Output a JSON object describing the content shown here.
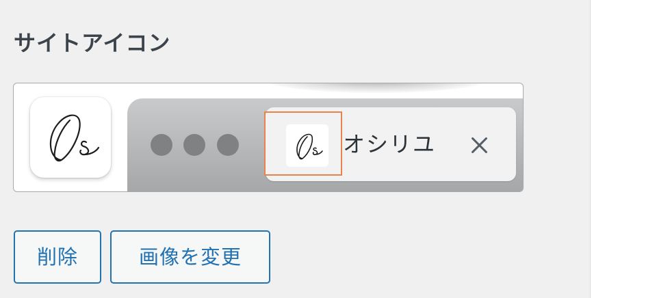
{
  "section": {
    "title": "サイトアイコン"
  },
  "preview": {
    "tab_title": "オシリユ",
    "app_icon": "os-signature-logo",
    "favicon": "os-signature-logo",
    "close_icon": "close-icon",
    "window_dots": 3
  },
  "buttons": {
    "remove_label": "削除",
    "change_label": "画像を変更"
  },
  "colors": {
    "accent": "#2271b1",
    "highlight": "#e8834b",
    "panel_bg": "#f0f0f1",
    "text": "#3c434a"
  }
}
